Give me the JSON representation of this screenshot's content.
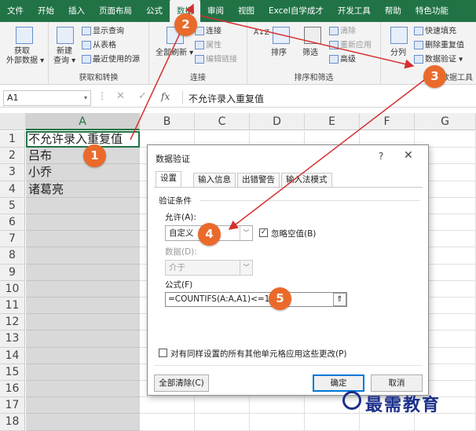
{
  "ribbon_tabs": [
    {
      "label": "文件",
      "active": false
    },
    {
      "label": "开始",
      "active": false
    },
    {
      "label": "插入",
      "active": false
    },
    {
      "label": "页面布局",
      "active": false
    },
    {
      "label": "公式",
      "active": false
    },
    {
      "label": "数据",
      "active": true
    },
    {
      "label": "审阅",
      "active": false
    },
    {
      "label": "视图",
      "active": false
    },
    {
      "label": "Excel自学成才",
      "active": false
    },
    {
      "label": "开发工具",
      "active": false
    },
    {
      "label": "帮助",
      "active": false
    },
    {
      "label": "特色功能",
      "active": false
    }
  ],
  "ribbon": {
    "get_data": {
      "line1": "获取",
      "line2": "外部数据"
    },
    "new_query": {
      "line1": "新建",
      "line2": "查询"
    },
    "show_query": "显示查询",
    "from_table": "从表格",
    "recent_sources": "最近使用的源",
    "group_get_transform": "获取和转换",
    "refresh_all": "全部刷新",
    "connections": "连接",
    "properties": "属性",
    "edit_links": "编辑链接",
    "group_connections": "连接",
    "sort_az": "A↓Z",
    "sort": "排序",
    "filter": "筛选",
    "clear": "清除",
    "reapply": "重新应用",
    "advanced": "高级",
    "group_sort_filter": "排序和筛选",
    "split_columns": "分列",
    "flash_fill": "快速填充",
    "remove_duplicates": "删除重复值",
    "data_validation": "数据验证",
    "group_data_tools": "数据工具"
  },
  "formula_bar": {
    "name_box": "A1",
    "fx": "fx",
    "content": "不允许录入重复值"
  },
  "grid": {
    "columns": [
      "A",
      "B",
      "C",
      "D",
      "E",
      "F",
      "G"
    ],
    "rows": [
      "1",
      "2",
      "3",
      "4",
      "5",
      "6",
      "7",
      "8",
      "9",
      "10",
      "11",
      "12",
      "13",
      "14",
      "15",
      "16",
      "17",
      "18"
    ],
    "column_a": [
      "不允许录入重复值",
      "吕布",
      "小乔",
      "诸葛亮"
    ]
  },
  "dialog": {
    "title": "数据验证",
    "help": "?",
    "close": "✕",
    "tabs": [
      "设置",
      "输入信息",
      "出错警告",
      "输入法模式"
    ],
    "criteria_label": "验证条件",
    "allow_label": "允许(A):",
    "allow_value": "自定义",
    "ignore_blank": "忽略空值(B)",
    "data_label": "数据(D):",
    "data_value": "介于",
    "formula_label": "公式(F)",
    "formula_value": "=COUNTIFS(A:A,A1)<=1",
    "apply_all": "对有同样设置的所有其他单元格应用这些更改(P)",
    "clear_all": "全部清除(C)",
    "ok": "确定",
    "cancel": "取消"
  },
  "callouts": [
    "1",
    "2",
    "3",
    "4",
    "5"
  ],
  "watermark": "最需教育",
  "colors": {
    "excel_green": "#217346",
    "callout": "#ea6a2b",
    "arrow": "#d62f2f",
    "watermark": "#1b2f8a"
  }
}
